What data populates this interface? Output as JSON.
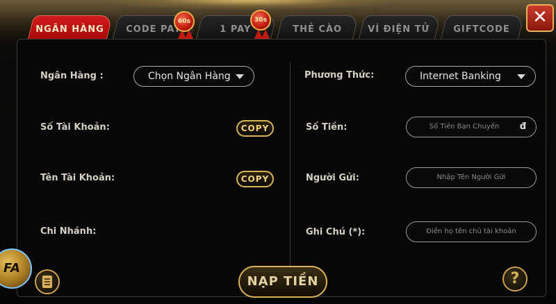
{
  "tabs": [
    {
      "label": "NGÂN HÀNG",
      "active": true
    },
    {
      "label": "CODE PAY",
      "active": false,
      "badge": "60s"
    },
    {
      "label": "1 PAY",
      "active": false,
      "badge": "30s"
    },
    {
      "label": "THẺ CÀO",
      "active": false
    },
    {
      "label": "VÍ ĐIỆN TỬ",
      "active": false
    },
    {
      "label": "GIFTCODE",
      "active": false
    }
  ],
  "close_icon": "✕",
  "left_form": {
    "bank_label": "Ngân Hàng :",
    "bank_select": "Chọn Ngân Hàng",
    "account_number_label": "Số Tài Khoản:",
    "account_name_label": "Tên Tài Khoản:",
    "branch_label": "Chi Nhánh:",
    "copy_label": "COPY"
  },
  "right_form": {
    "method_label": "Phương Thức:",
    "method_select": "Internet Banking",
    "amount_label": "Số Tiền:",
    "amount_placeholder": "Số Tiền Bạn Chuyển",
    "currency_symbol": "đ",
    "sender_label": "Người Gửi:",
    "sender_placeholder": "Nhập Tên Người Gửi",
    "note_label": "Ghi Chú (*):",
    "note_placeholder": "Điền họ tên chủ tài khoản"
  },
  "footer": {
    "submit_label": "NẠP TIỀN",
    "help_icon": "?",
    "logo_text": "FA"
  },
  "colors": {
    "active_tab": "#c41212",
    "gold_border": "#d9b15a",
    "background": "#050505"
  }
}
